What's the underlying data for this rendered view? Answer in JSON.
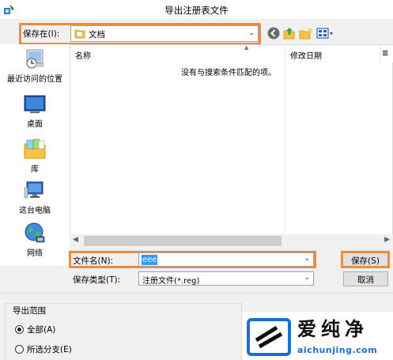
{
  "window": {
    "title": "导出注册表文件"
  },
  "savein": {
    "label": "保存在(I):",
    "value": "文档"
  },
  "places": [
    {
      "label": "最近访问的位置",
      "icon": "recent-places-icon"
    },
    {
      "label": "桌面",
      "icon": "desktop-icon"
    },
    {
      "label": "库",
      "icon": "libraries-icon"
    },
    {
      "label": "这台电脑",
      "icon": "this-pc-icon"
    },
    {
      "label": "网络",
      "icon": "network-icon"
    }
  ],
  "filelist": {
    "columns": [
      "名称",
      "修改日期",
      "≣"
    ],
    "empty_message": "没有与搜索条件匹配的项。"
  },
  "filename": {
    "label": "文件名(N):",
    "value": "eee"
  },
  "filetype": {
    "label": "保存类型(T):",
    "value": "注册文件(*.reg)"
  },
  "buttons": {
    "save": "保存(S)",
    "cancel": "取消"
  },
  "export_range": {
    "title": "导出范围",
    "options": [
      {
        "label": "全部(A)",
        "checked": true
      },
      {
        "label": "所选分支(E)",
        "checked": false
      }
    ]
  },
  "watermark": {
    "brand": "爱纯净",
    "url": "aichunjing.com"
  },
  "colors": {
    "highlight": "#f08a3c",
    "selection": "#3399ff"
  }
}
